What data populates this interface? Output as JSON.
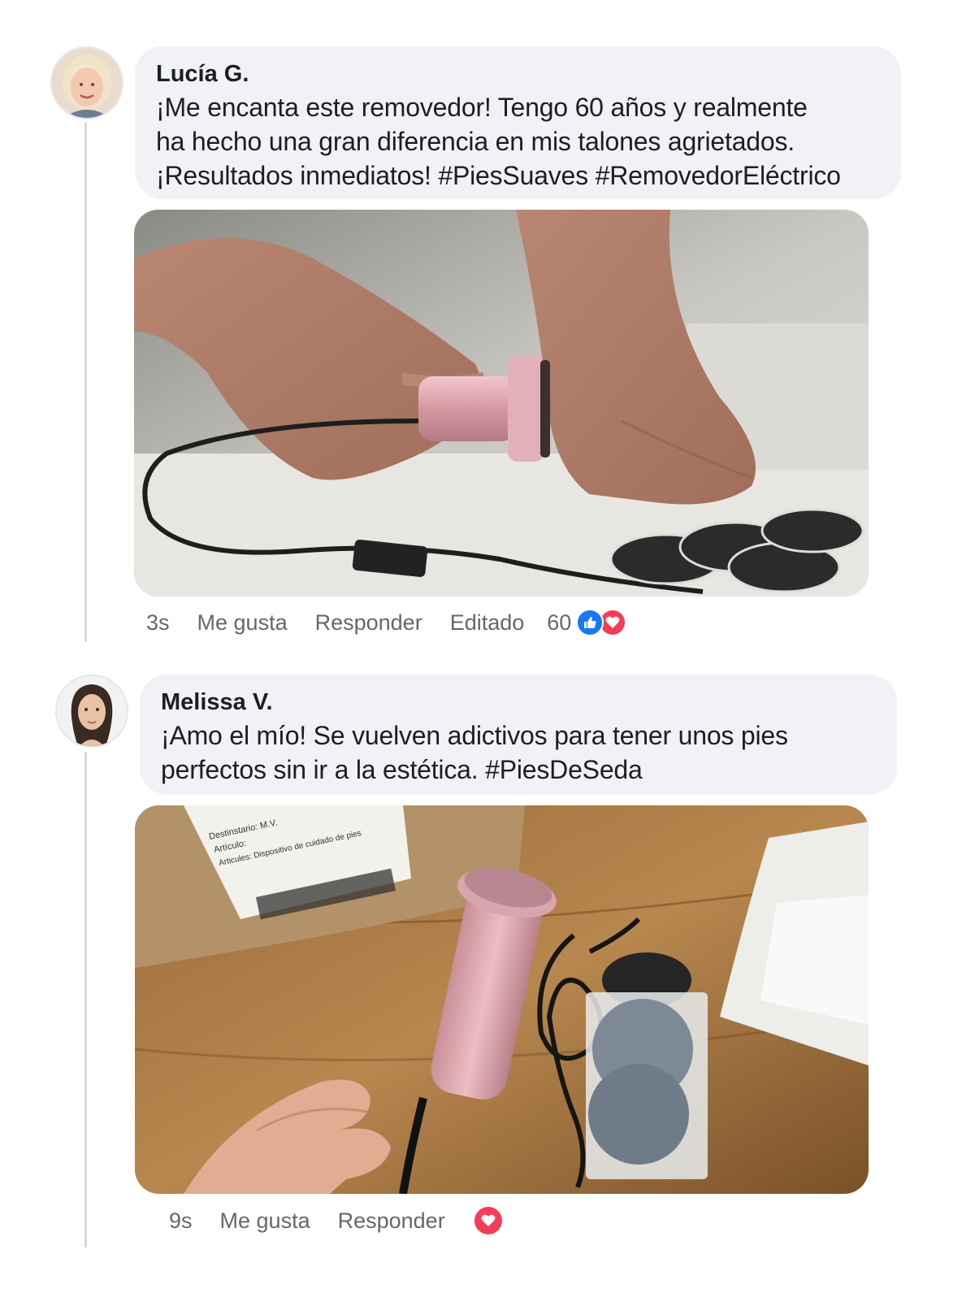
{
  "comments": [
    {
      "author": "Lucía G.",
      "lines": [
        "¡Me encanta este removedor! Tengo 60 años y realmente",
        "ha hecho una gran diferencia en mis talones agrietados.",
        "¡Resultados inmediatos! #PiesSuaves #RemovedorEléctrico"
      ],
      "time": "3s",
      "like_label": "Me gusta",
      "reply_label": "Responder",
      "edited_label": "Editado",
      "reaction_count": "60",
      "reactions": [
        "like-icon",
        "love-icon"
      ]
    },
    {
      "author": "Melissa V.",
      "lines": [
        "¡Amo el mío! Se vuelven adictivos para tener unos pies",
        "perfectos sin ir a la estética. #PiesDeSeda"
      ],
      "time": "9s",
      "like_label": "Me gusta",
      "reply_label": "Responder",
      "reactions": [
        "love-icon"
      ]
    }
  ],
  "photos": {
    "photo2_label": {
      "recipient": "Destinstario: M.V.",
      "article": "Artículo:",
      "articles": "Articules: Dispositivo de cuidado de pies"
    }
  },
  "colors": {
    "bubble": "#f0f2f5",
    "action_text": "#65676b",
    "like_blue": "#1877f2",
    "love_red": "#f33e58",
    "device_pink": "#d9a3ac"
  }
}
